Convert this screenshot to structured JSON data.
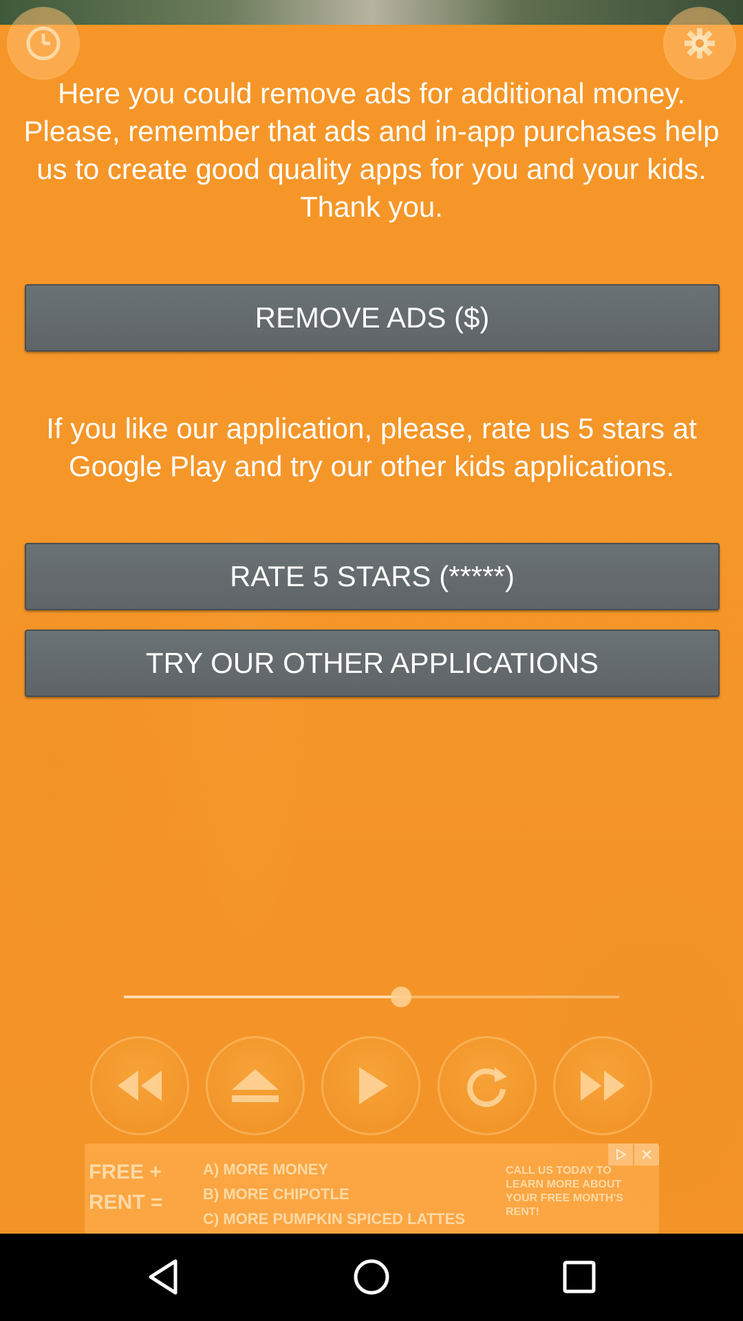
{
  "content": {
    "remove_ads_text": "Here you could remove ads for additional money. Please, remember that ads and in-app purchases help us to create good quality apps for you and your kids. Thank you.",
    "remove_ads_button": "REMOVE ADS ($)",
    "rate_text": "If you like our application, please, rate us 5 stars at Google Play and try our other kids applications.",
    "rate_button": "RATE 5 STARS (*****)",
    "other_apps_button": "TRY OUR OTHER APPLICATIONS"
  },
  "top_controls": {
    "left_icon": "timer-icon",
    "right_icon": "settings-gear-icon"
  },
  "player": {
    "progress_fraction": 0.56,
    "controls": [
      "rewind-icon",
      "eject-icon",
      "play-icon",
      "repeat-icon",
      "fast-forward-icon"
    ]
  },
  "ad_banner": {
    "left_line1": "FREE +",
    "left_line2": "RENT =",
    "option_a": "A) MORE MONEY",
    "option_b": "B) MORE CHIPOTLE",
    "option_c": "C) MORE PUMPKIN SPICED LATTES",
    "cta": "CALL US TODAY TO LEARN MORE ABOUT YOUR FREE MONTH'S RENT!"
  },
  "nav": [
    "back-icon",
    "home-icon",
    "recent-apps-icon"
  ],
  "colors": {
    "accent_orange": "#f59a2a",
    "button_gray": "#666c6f"
  }
}
